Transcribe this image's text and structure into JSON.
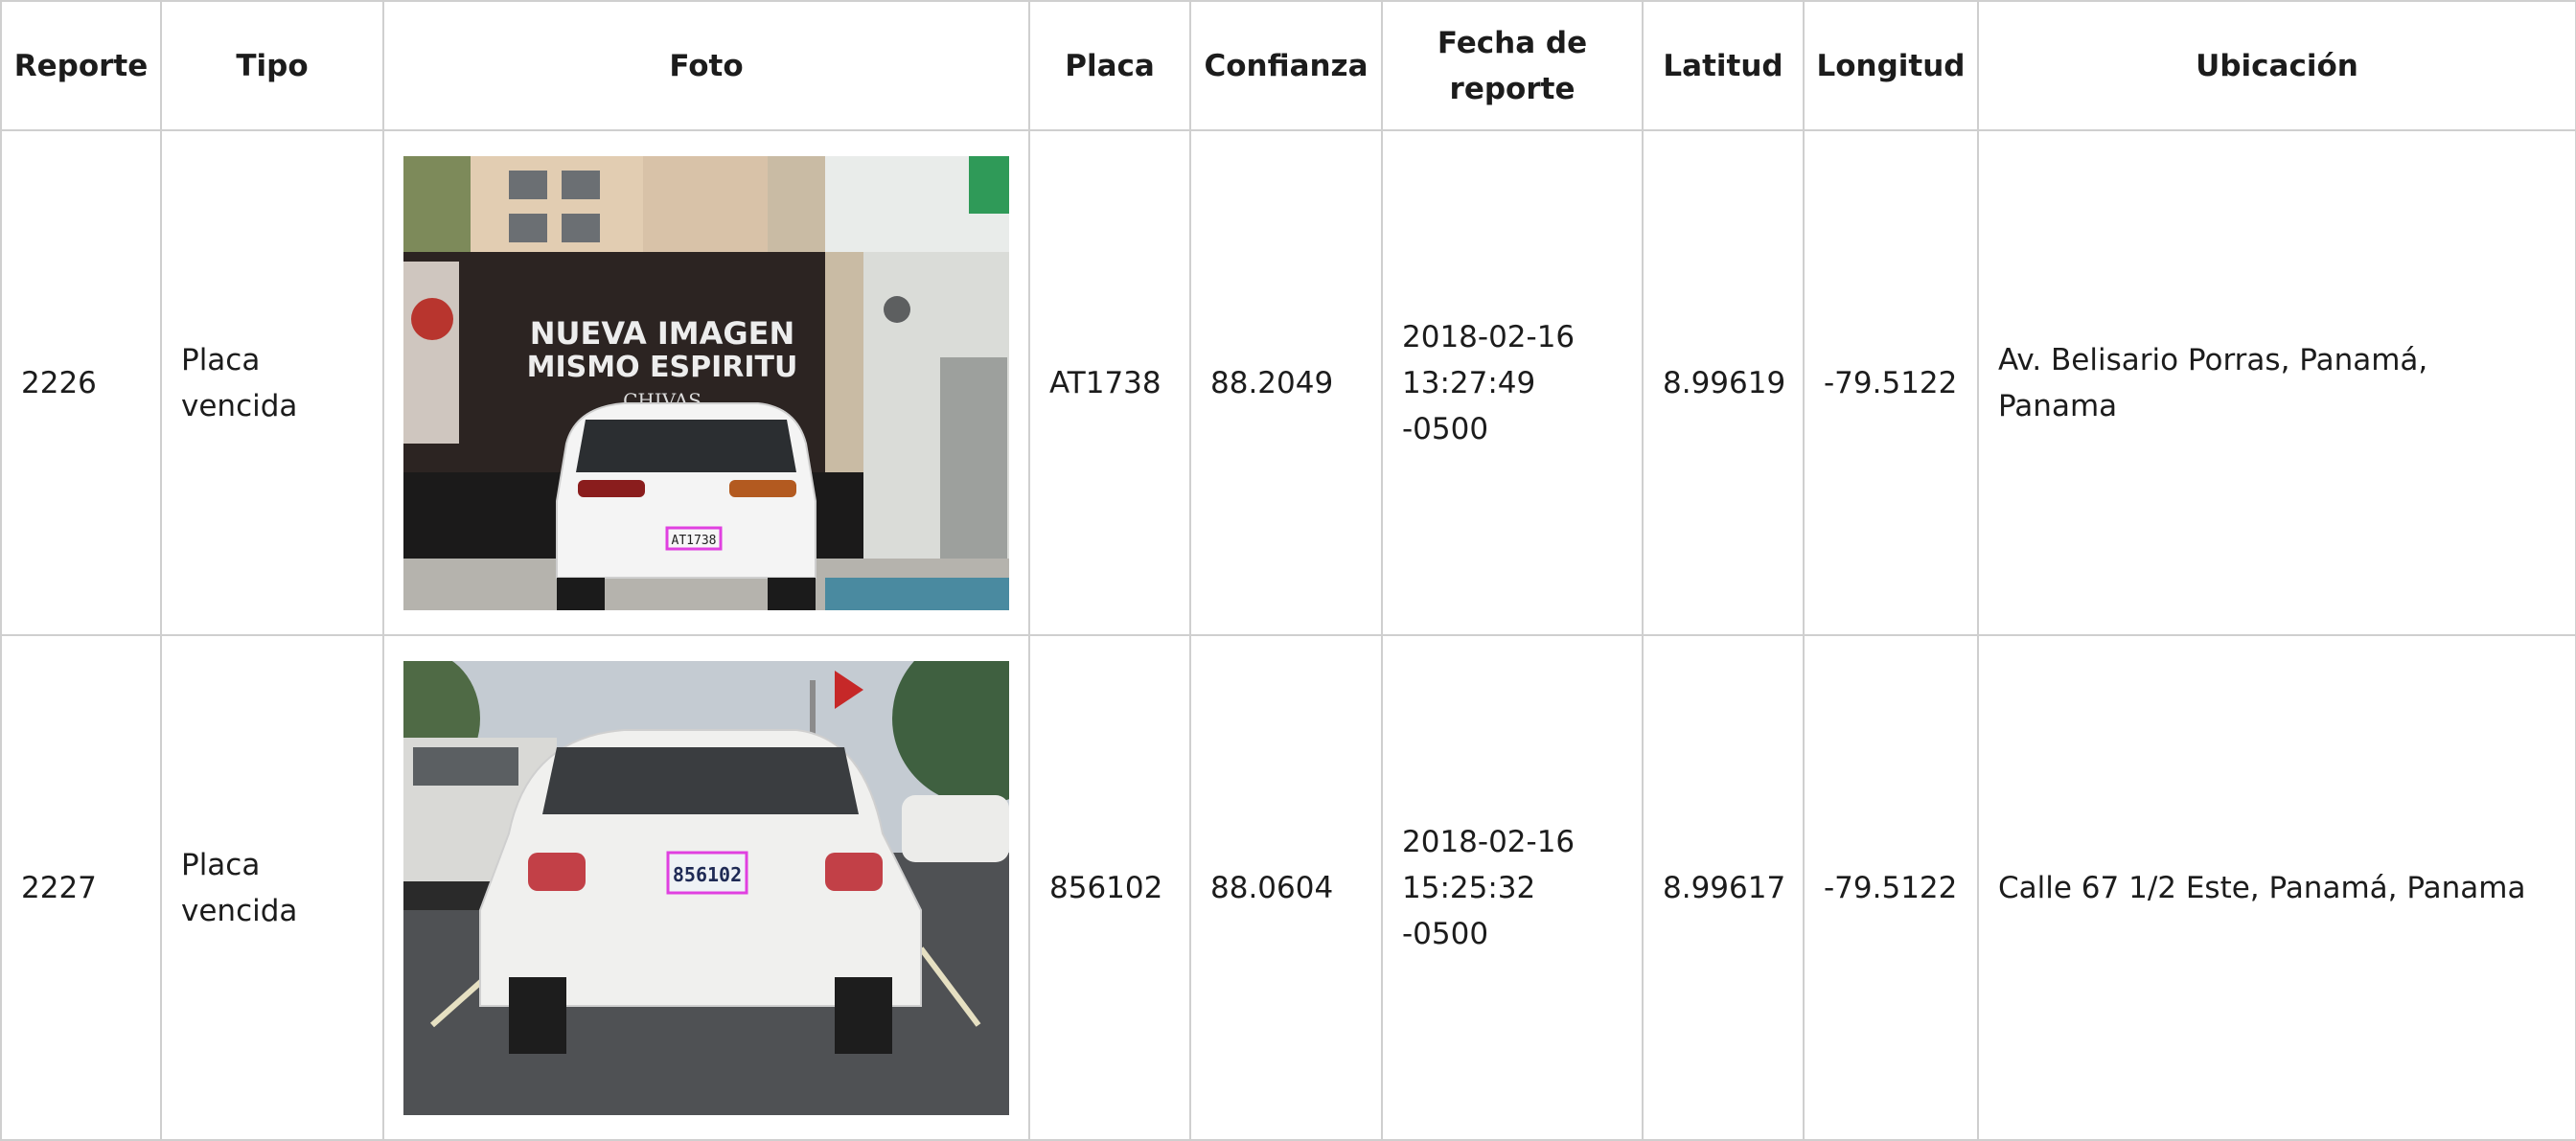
{
  "headers": {
    "reporte": "Reporte",
    "tipo": "Tipo",
    "foto": "Foto",
    "placa": "Placa",
    "confianza": "Confianza",
    "fecha_line1": "Fecha de",
    "fecha_line2": "reporte",
    "latitud": "Latitud",
    "longitud": "Longitud",
    "ubicacion": "Ubicación"
  },
  "rows": [
    {
      "reporte": "2226",
      "tipo_line1": "Placa",
      "tipo_line2": "vencida",
      "placa": "AT1738",
      "confianza": "88.2049",
      "fecha_line1": "2018-02-16",
      "fecha_line2": "13:27:49 -0500",
      "latitud": "8.99619",
      "longitud": "-79.5122",
      "ubicacion": "Av. Belisario Porras, Panamá, Panama",
      "photo": {
        "billboard_line1": "NUEVA IMAGEN",
        "billboard_line2": "MISMO ESPIRITU",
        "billboard_brand": "CHIVAS",
        "plate_text": "AT1738"
      }
    },
    {
      "reporte": "2227",
      "tipo_line1": "Placa",
      "tipo_line2": "vencida",
      "placa": "856102",
      "confianza": "88.0604",
      "fecha_line1": "2018-02-16",
      "fecha_line2": "15:25:32 -0500",
      "latitud": "8.99617",
      "longitud": "-79.5122",
      "ubicacion": "Calle 67 1/2 Este, Panamá, Panama",
      "photo": {
        "plate_text": "856102"
      }
    }
  ],
  "colors": {
    "border": "#cfcfcf",
    "text": "#1c1c1c",
    "plate_box": "#e040e0"
  }
}
